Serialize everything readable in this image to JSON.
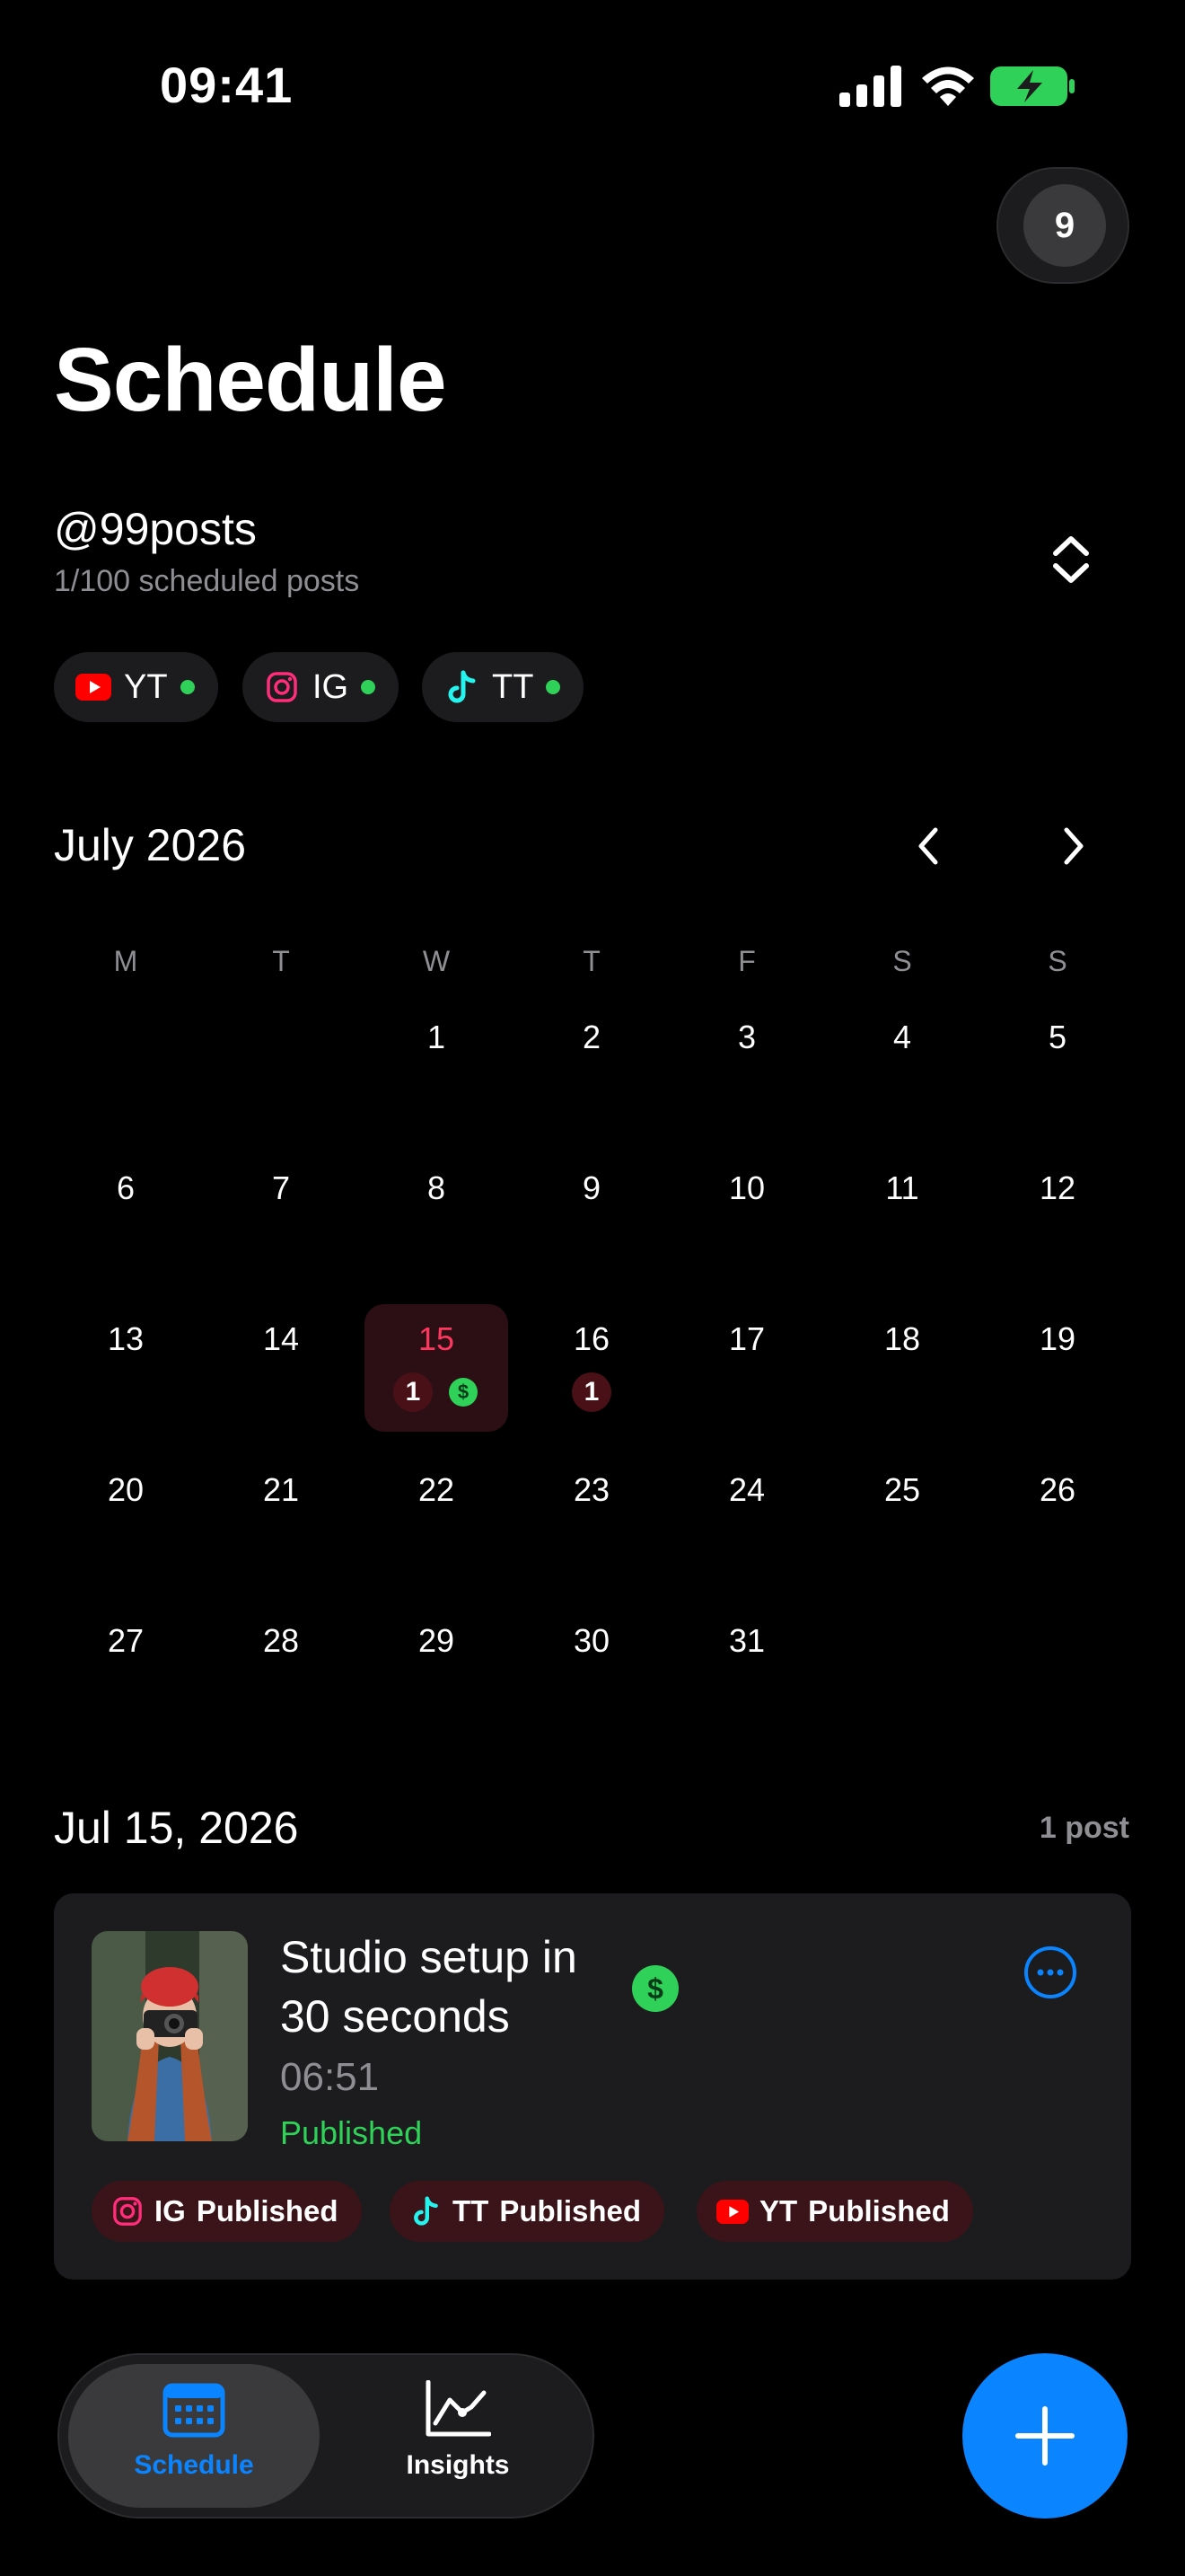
{
  "status_bar": {
    "time": "09:41"
  },
  "header": {
    "avatar_count": "9",
    "title": "Schedule"
  },
  "account": {
    "handle": "@99posts",
    "subtitle": "1/100 scheduled posts"
  },
  "platforms": [
    {
      "label": "YT",
      "icon": "youtube-icon",
      "status_color": "#30d158"
    },
    {
      "label": "IG",
      "icon": "instagram-icon",
      "status_color": "#30d158"
    },
    {
      "label": "TT",
      "icon": "tiktok-icon",
      "status_color": "#30d158"
    }
  ],
  "calendar": {
    "month_label": "July 2026",
    "weekdays": [
      "M",
      "T",
      "W",
      "T",
      "F",
      "S",
      "S"
    ],
    "days": [
      "1",
      "2",
      "3",
      "4",
      "5",
      "6",
      "7",
      "8",
      "9",
      "10",
      "11",
      "12",
      "13",
      "14",
      "15",
      "16",
      "17",
      "18",
      "19",
      "20",
      "21",
      "22",
      "23",
      "24",
      "25",
      "26",
      "27",
      "28",
      "29",
      "30",
      "31"
    ],
    "selected_day": "15",
    "day_counts": {
      "15": "1",
      "16": "1"
    },
    "day_money_icon": {
      "15": "$"
    }
  },
  "selected_date": {
    "label": "Jul 15, 2026",
    "count_label": "1 post"
  },
  "post": {
    "title": "Studio setup in 30 seconds",
    "money_icon": "$",
    "time": "06:51",
    "status": "Published",
    "platform_statuses": [
      {
        "platform": "IG",
        "status": "Published",
        "icon": "instagram-icon"
      },
      {
        "platform": "TT",
        "status": "Published",
        "icon": "tiktok-icon"
      },
      {
        "platform": "YT",
        "status": "Published",
        "icon": "youtube-icon"
      }
    ]
  },
  "tabbar": {
    "tabs": [
      {
        "label": "Schedule",
        "icon": "calendar-icon",
        "active": true
      },
      {
        "label": "Insights",
        "icon": "chart-icon",
        "active": false
      }
    ]
  },
  "colors": {
    "accent": "#0a84ff",
    "success": "#30d158",
    "highlight": "#ff375f",
    "background": "#000000",
    "card": "#1c1c1e"
  }
}
